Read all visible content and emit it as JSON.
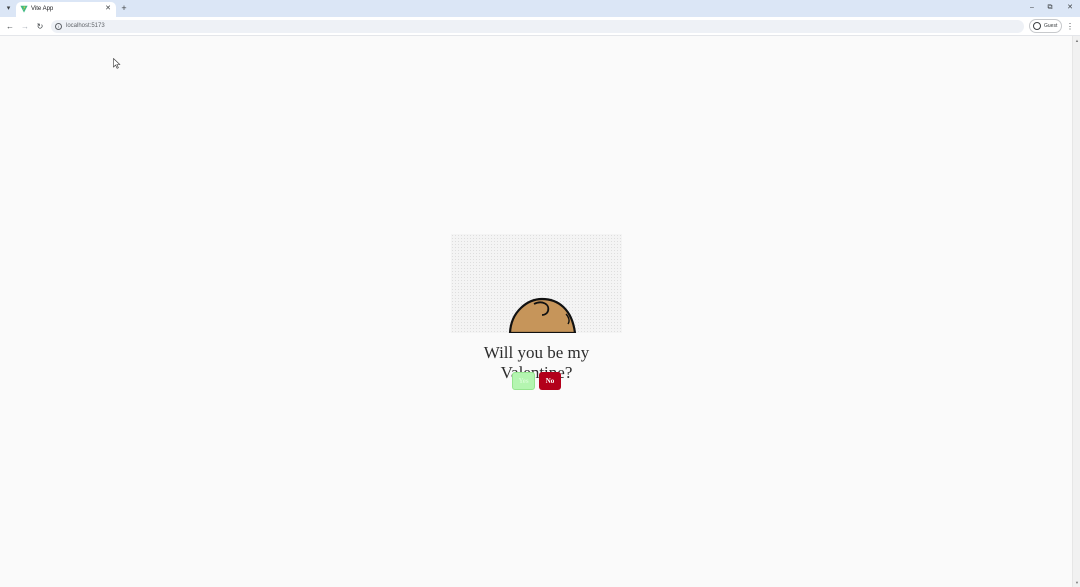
{
  "browser": {
    "tab": {
      "title": "Vite App",
      "close_glyph": "✕"
    },
    "tab_menu_glyph": "▾",
    "new_tab_glyph": "+",
    "window": {
      "minimize_glyph": "–",
      "maximize_glyph": "⧉",
      "close_glyph": "✕"
    },
    "nav": {
      "back_glyph": "←",
      "forward_glyph": "→",
      "reload_glyph": "↻"
    },
    "address_bar": {
      "url": "localhost:5173",
      "site_info_glyph": "i"
    },
    "profile": {
      "label": "Guest"
    },
    "menu_glyph": "⋮"
  },
  "page": {
    "question": "Will you be my Valentine?",
    "yes_label": "Yes",
    "no_label": "No"
  },
  "icons": {
    "favicon": "vite-icon",
    "cursor": "mouse-pointer-icon",
    "profile": "person-icon"
  },
  "colors": {
    "yes_button": "#b4f5b0",
    "no_button": "#b3001b",
    "bear": "#c6955a",
    "page_background": "#fafafa",
    "tabbar": "#dbe6f6"
  }
}
